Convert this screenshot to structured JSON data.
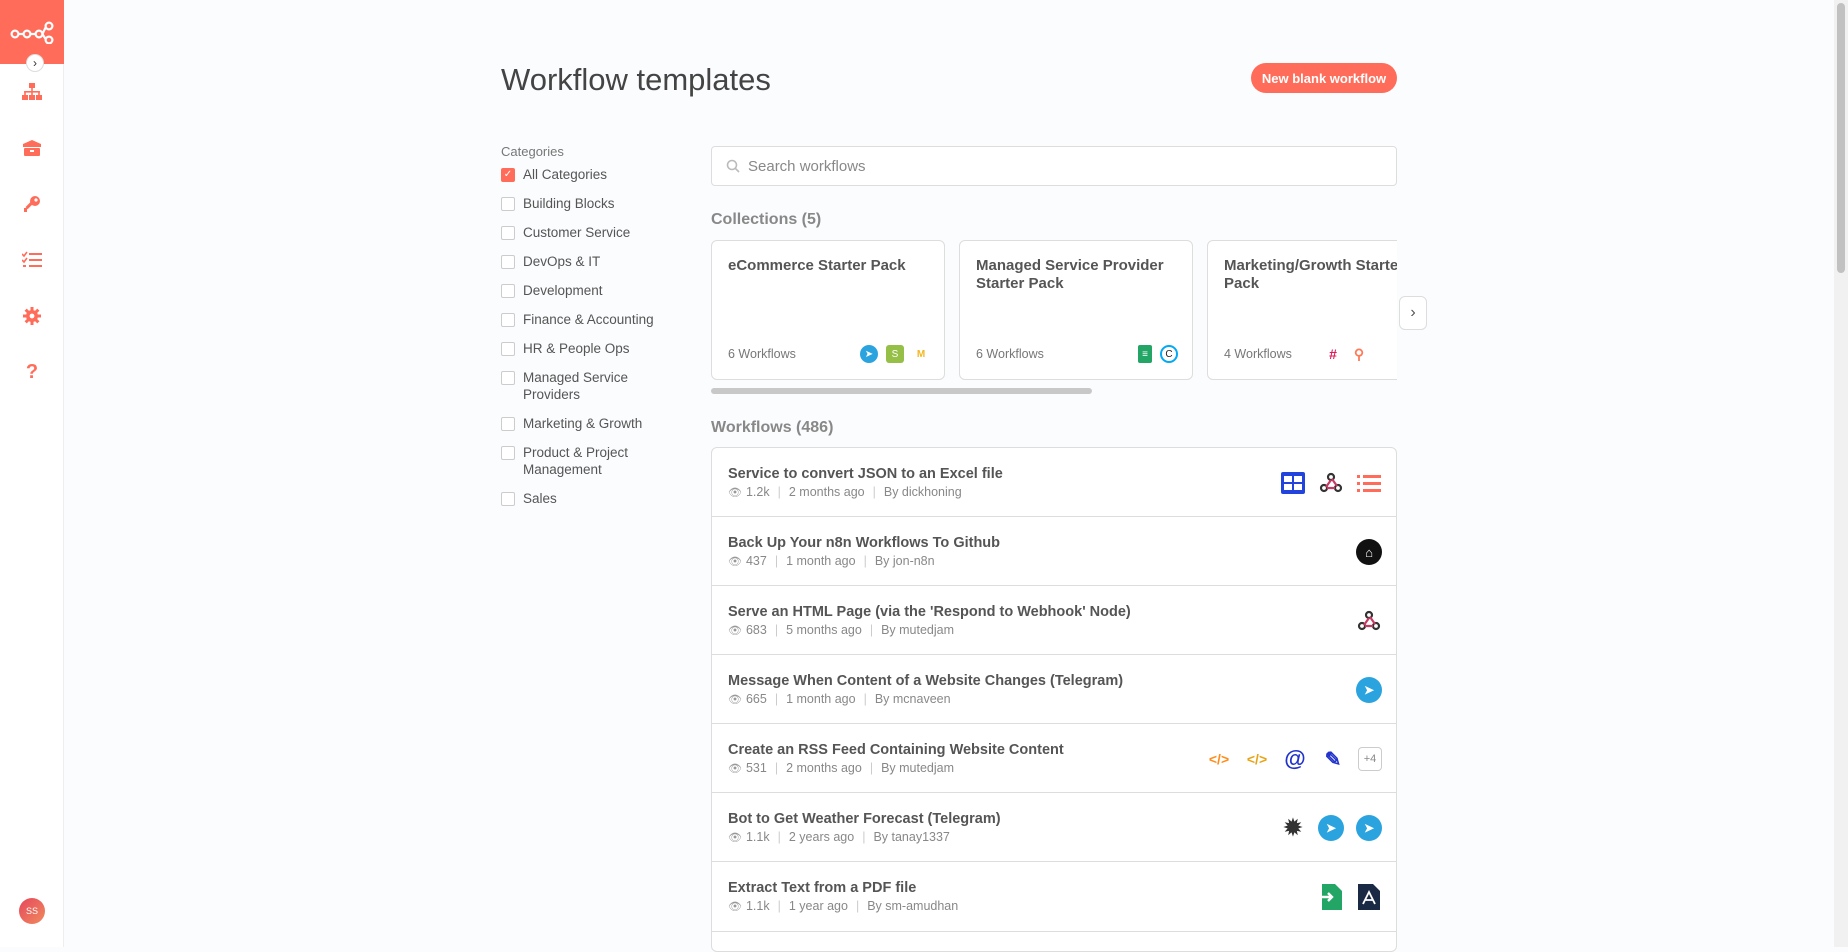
{
  "page": {
    "title": "Workflow templates",
    "new_button": "New blank workflow"
  },
  "sidebar": {
    "expand_glyph": "›",
    "avatar_initials": "SS",
    "items": [
      {
        "name": "workflows-icon"
      },
      {
        "name": "templates-icon"
      },
      {
        "name": "credentials-icon"
      },
      {
        "name": "executions-icon"
      },
      {
        "name": "settings-icon"
      },
      {
        "name": "help-icon"
      }
    ]
  },
  "categories": {
    "heading": "Categories",
    "items": [
      {
        "label": "All Categories",
        "checked": true
      },
      {
        "label": "Building Blocks",
        "checked": false
      },
      {
        "label": "Customer Service",
        "checked": false
      },
      {
        "label": "DevOps & IT",
        "checked": false
      },
      {
        "label": "Development",
        "checked": false
      },
      {
        "label": "Finance & Accounting",
        "checked": false
      },
      {
        "label": "HR & People Ops",
        "checked": false
      },
      {
        "label": "Managed Service Providers",
        "checked": false
      },
      {
        "label": "Marketing & Growth",
        "checked": false
      },
      {
        "label": "Product & Project Management",
        "checked": false
      },
      {
        "label": "Sales",
        "checked": false
      }
    ]
  },
  "search": {
    "placeholder": "Search workflows",
    "value": ""
  },
  "collections": {
    "heading": "Collections (5)",
    "next_glyph": "›",
    "items": [
      {
        "title": "eCommerce Starter Pack",
        "count": "6 Workflows",
        "icons": [
          "telegram-icon",
          "shopify-icon",
          "mautic-icon"
        ]
      },
      {
        "title": "Managed Service Provider Starter Pack",
        "count": "6 Workflows",
        "icons": [
          "google-sheets-icon",
          "clockify-icon"
        ]
      },
      {
        "title": "Marketing/Growth Starter Pack",
        "count": "4 Workflows",
        "icons": [
          "slack-icon",
          "hubspot-icon"
        ]
      }
    ]
  },
  "workflows": {
    "heading": "Workflows (486)",
    "items": [
      {
        "title": "Service to convert JSON to an Excel file",
        "views": "1.2k",
        "age": "2 months ago",
        "author": "By dickhoning",
        "icons": [
          "spreadsheet-icon",
          "webhook-icon",
          "item-lists-icon"
        ],
        "more": ""
      },
      {
        "title": "Back Up Your n8n Workflows To Github",
        "views": "437",
        "age": "1 month ago",
        "author": "By jon-n8n",
        "icons": [
          "github-icon"
        ],
        "more": ""
      },
      {
        "title": "Serve an HTML Page (via the 'Respond to Webhook' Node)",
        "views": "683",
        "age": "5 months ago",
        "author": "By mutedjam",
        "icons": [
          "webhook-icon"
        ],
        "more": ""
      },
      {
        "title": "Message When Content of a Website Changes (Telegram)",
        "views": "665",
        "age": "1 month ago",
        "author": "By mcnaveen",
        "icons": [
          "telegram-icon"
        ],
        "more": ""
      },
      {
        "title": "Create an RSS Feed Containing Website Content",
        "views": "531",
        "age": "2 months ago",
        "author": "By mutedjam",
        "icons": [
          "html-extract-icon",
          "html-icon",
          "email-icon",
          "edit-icon"
        ],
        "more": "+4"
      },
      {
        "title": "Bot to Get Weather Forecast (Telegram)",
        "views": "1.1k",
        "age": "2 years ago",
        "author": "By tanay1337",
        "icons": [
          "openweathermap-icon",
          "telegram-icon",
          "telegram-icon"
        ],
        "more": ""
      },
      {
        "title": "Extract Text from a PDF file",
        "views": "1.1k",
        "age": "1 year ago",
        "author": "By sm-amudhan",
        "icons": [
          "read-binary-file-icon",
          "pdf-icon"
        ],
        "more": ""
      }
    ]
  },
  "colors": {
    "accent": "#ff6d5a"
  }
}
